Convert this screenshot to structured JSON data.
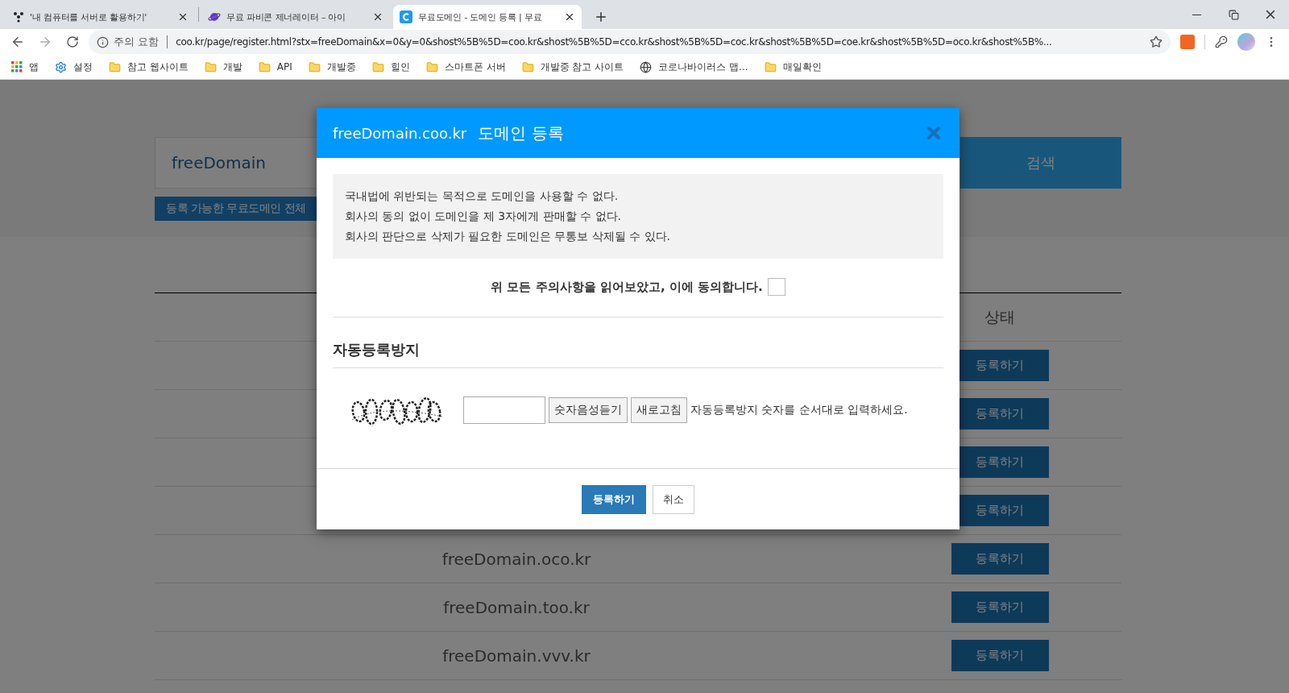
{
  "browser": {
    "tabs": [
      {
        "title": "'내 컴퓨터를 서버로 활용하기'",
        "selected": false
      },
      {
        "title": "무료 파비콘 제너레이터 – 아이",
        "selected": false
      },
      {
        "title": "무료도메인 - 도메인 등록 | 무료",
        "selected": true
      }
    ],
    "address": {
      "security": "주의 요함",
      "url": "coo.kr/page/register.html?stx=freeDomain&x=0&y=0&shost%5B%5D=coo.kr&shost%5B%5D=cco.kr&shost%5B%5D=coc.kr&shost%5B%5D=coe.kr&shost%5B%5D=oco.kr&shost%5B%..."
    },
    "bookmarks": [
      {
        "label": "앱",
        "kind": "apps"
      },
      {
        "label": "설정",
        "kind": "settings"
      },
      {
        "label": "참고 웹사이트",
        "kind": "folder"
      },
      {
        "label": "개발",
        "kind": "folder"
      },
      {
        "label": "API",
        "kind": "folder"
      },
      {
        "label": "개발중",
        "kind": "folder"
      },
      {
        "label": "힐인",
        "kind": "folder"
      },
      {
        "label": "스마트폰 서버",
        "kind": "folder"
      },
      {
        "label": "개발중 참고 사이트",
        "kind": "folder"
      },
      {
        "label": "코로나바이러스 맵...",
        "kind": "site"
      },
      {
        "label": "매일확인",
        "kind": "folder"
      }
    ]
  },
  "page": {
    "search": {
      "value": "freeDomain",
      "button": "검색"
    },
    "all_link": "등록 가능한 무료도메인 전체",
    "table": {
      "columns": [
        "상태"
      ],
      "rows": [
        {
          "action": "등록하기"
        },
        {
          "action": "등록하기"
        },
        {
          "action": "등록하기"
        },
        {
          "action": "등록하기"
        },
        {
          "domain": "freeDomain.oco.kr",
          "action": "등록하기"
        },
        {
          "domain": "freeDomain.too.kr",
          "action": "등록하기"
        },
        {
          "domain": "freeDomain.vvv.kr",
          "action": "등록하기"
        }
      ]
    }
  },
  "modal": {
    "title_domain": "freeDomain.coo.kr",
    "title": "도메인 등록",
    "notices": [
      "국내법에 위반되는 목적으로 도메인을 사용할 수 없다.",
      "회사의 동의 없이 도메인을 제 3자에게 판매할 수 없다.",
      "회사의 판단으로 삭제가 필요한 도메인은 무통보 삭제될 수 있다."
    ],
    "agree": {
      "label": "위 모든 주의사항을 읽어보았고, 이에 동의합니다.",
      "checked": false
    },
    "captcha": {
      "heading": "자동등록방지",
      "listen_button": "숫자음성듣기",
      "refresh_button": "새로고침",
      "hint": "자동등록방지 숫자를 순서대로 입력하세요."
    },
    "buttons": [
      {
        "label": "등록하기",
        "kind": "primary"
      },
      {
        "label": "취소",
        "kind": "default"
      }
    ]
  }
}
